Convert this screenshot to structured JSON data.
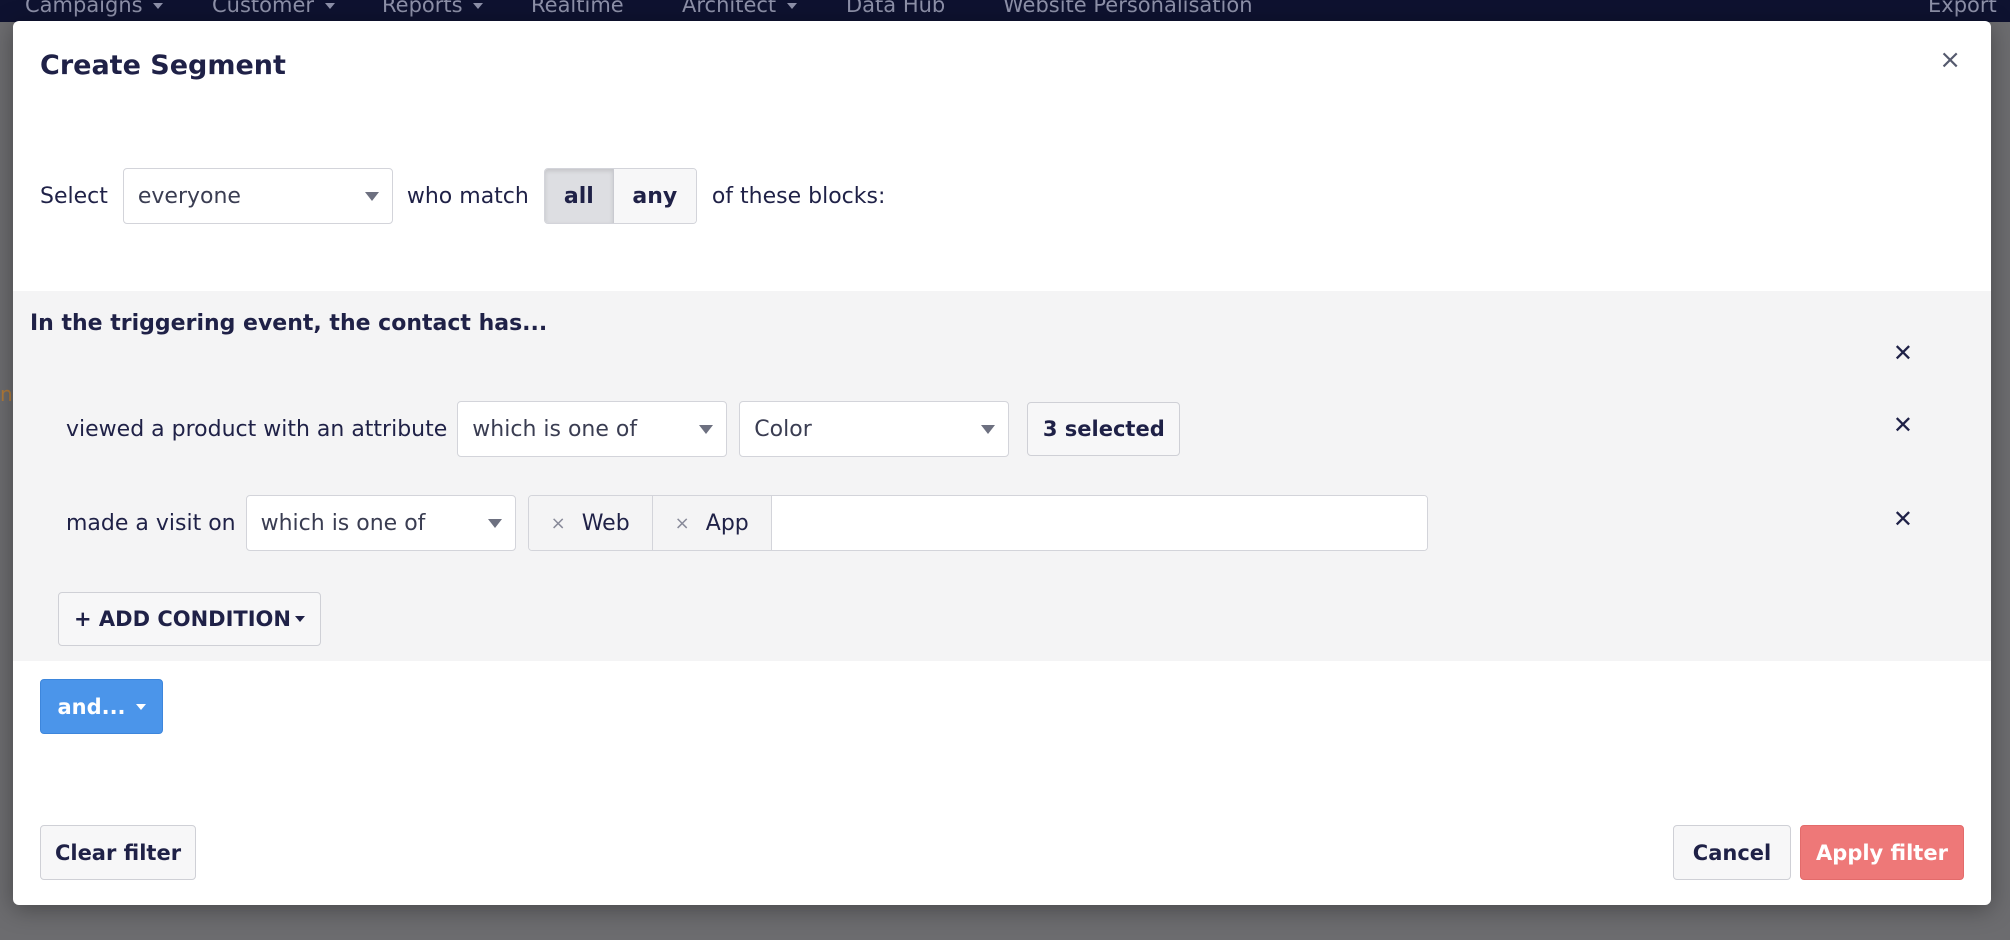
{
  "background": {
    "nav_items": [
      {
        "label": "Campaigns",
        "dropdown": true
      },
      {
        "label": "Customer",
        "dropdown": true
      },
      {
        "label": "Reports",
        "dropdown": true
      },
      {
        "label": "Realtime",
        "dropdown": false
      },
      {
        "label": "Architect",
        "dropdown": true
      },
      {
        "label": "Data Hub",
        "dropdown": false
      },
      {
        "label": "Website Personalisation",
        "dropdown": false
      }
    ],
    "right_item": "Export"
  },
  "modal": {
    "title": "Create Segment",
    "close_symbol": "×",
    "select_label": "Select",
    "audience_value": "everyone",
    "match_label": "who match",
    "match_options": [
      "all",
      "any"
    ],
    "match_selected": "all",
    "blocks_label": "of these blocks:"
  },
  "block": {
    "title": "In the triggering event, the contact has...",
    "remove_symbol": "✕",
    "conditions": [
      {
        "label": "viewed a product with an attribute",
        "operator": "which is one of",
        "attribute": "Color",
        "values_button": "3 selected"
      },
      {
        "label": "made a visit on",
        "operator": "which is one of",
        "tags": [
          "Web",
          "App"
        ],
        "tag_remove_symbol": "×"
      }
    ],
    "add_condition_label": "+ ADD CONDITION"
  },
  "and_button_label": "and...",
  "footer": {
    "clear_label": "Clear filter",
    "cancel_label": "Cancel",
    "apply_label": "Apply filter"
  },
  "colors": {
    "primary": "#4b95ea",
    "danger": "#ee7878",
    "navbar": "#0e1230",
    "block_bg": "#f4f4f5",
    "text": "#1f2147"
  },
  "icons": {
    "modal_close": "close-icon",
    "row_remove": "x-icon",
    "dropdown": "caret-down-icon"
  }
}
